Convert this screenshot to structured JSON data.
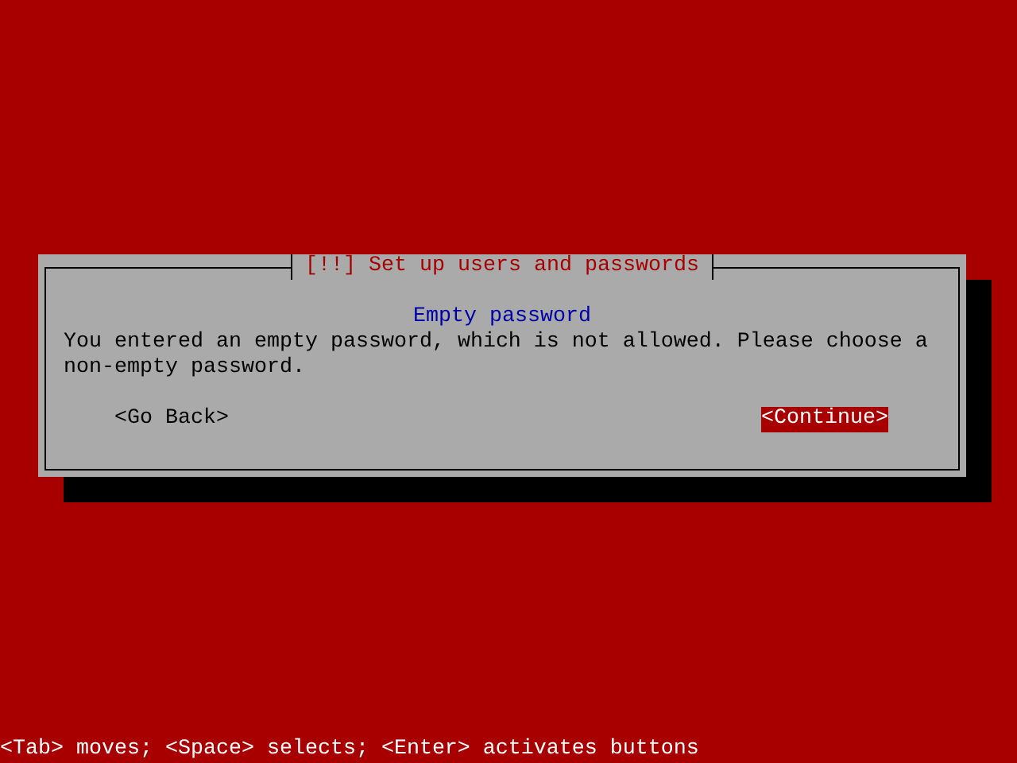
{
  "dialog": {
    "title": "[!!] Set up users and passwords",
    "heading": "Empty password",
    "message": "You entered an empty password, which is not allowed. Please choose a non-empty password.",
    "buttons": [
      {
        "label": "<Go Back>",
        "selected": false
      },
      {
        "label": "<Continue>",
        "selected": true
      }
    ]
  },
  "status_bar": "<Tab> moves; <Space> selects; <Enter> activates buttons"
}
